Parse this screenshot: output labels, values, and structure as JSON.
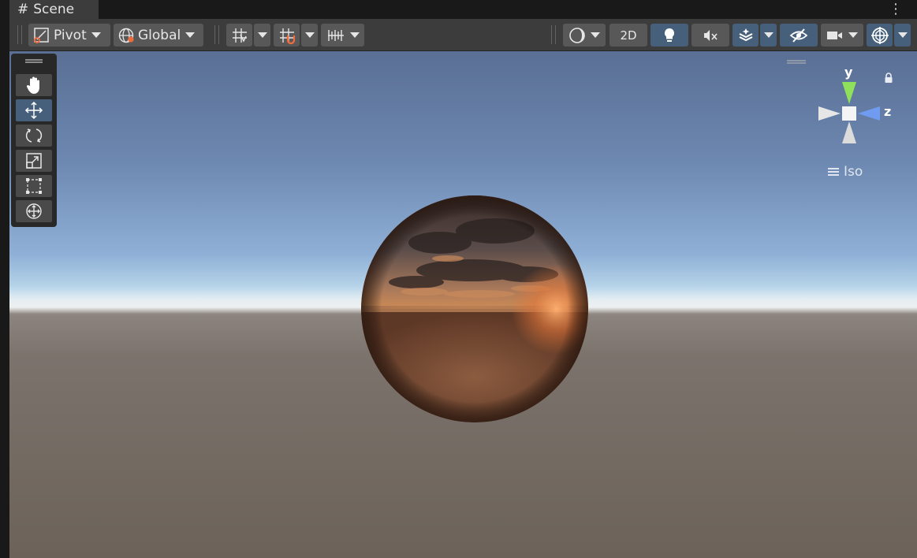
{
  "tab": {
    "icon": "grid-hash-icon",
    "title": "Scene"
  },
  "toolbar": {
    "pivot_label": "Pivot",
    "global_label": "Global",
    "two_d_label": "2D",
    "icons": [
      "pivot-icon",
      "globe-icon",
      "grid-snap-icon",
      "increment-snap-icon",
      "ruler-grid-icon",
      "draw-mode-icon",
      "lighting-icon",
      "audio-mute-icon",
      "effects-icon",
      "visibility-icon",
      "camera-icon",
      "gizmos-icon"
    ],
    "active_toggles": [
      "lighting",
      "effects",
      "visibility",
      "gizmos"
    ]
  },
  "tools": [
    {
      "id": "hand",
      "icon": "hand-icon",
      "active": false
    },
    {
      "id": "move",
      "icon": "move-icon",
      "active": true
    },
    {
      "id": "rotate",
      "icon": "rotate-icon",
      "active": false
    },
    {
      "id": "scale",
      "icon": "scale-icon",
      "active": false
    },
    {
      "id": "rect",
      "icon": "rect-transform-icon",
      "active": false
    },
    {
      "id": "transform",
      "icon": "transform-icon",
      "active": false
    }
  ],
  "gizmo": {
    "y_label": "y",
    "z_label": "z",
    "projection_label": "Iso"
  },
  "colors": {
    "active_blue": "#46607c",
    "y_axis": "#8fe05a",
    "z_axis": "#6f9cf0",
    "sphere_copper": "#b06a3a"
  }
}
